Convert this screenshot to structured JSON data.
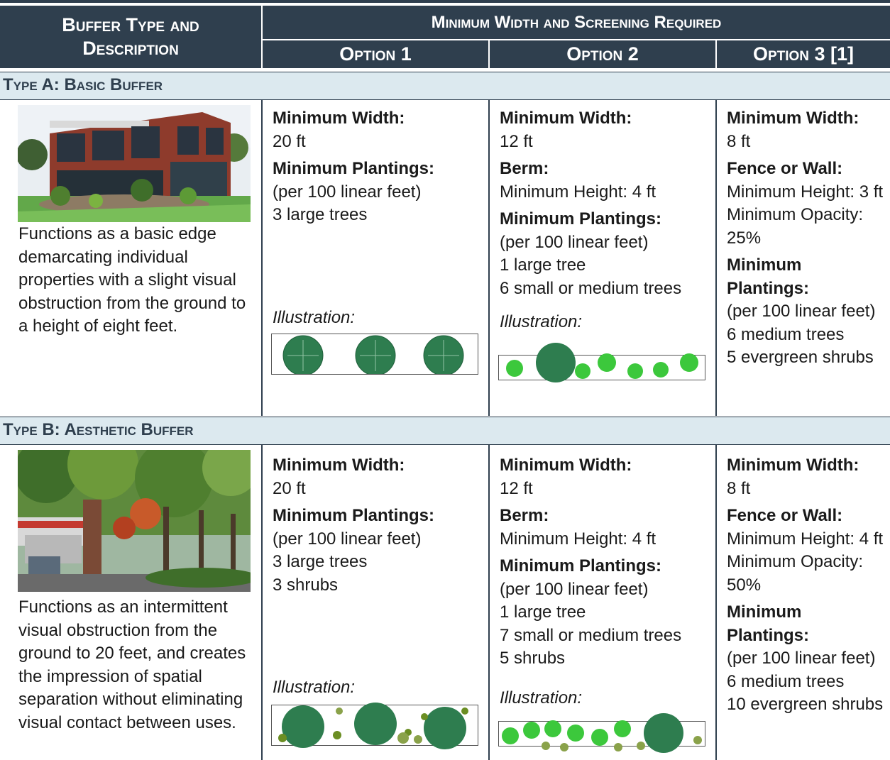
{
  "header": {
    "col1": "Buffer Type and Description",
    "group": "Minimum Width and Screening Required",
    "opt1": "Option 1",
    "opt2": "Option 2",
    "opt3": "Option 3 [1]"
  },
  "typeA": {
    "title": "Type A: Basic Buffer",
    "description": "Functions as a basic edge demarcating individual properties with a slight visual obstruction from the ground to a height of eight feet.",
    "opt1": {
      "width_label": "Minimum Width:",
      "width_value": "20 ft",
      "plant_label": "Minimum Plantings:",
      "plant_per": "(per 100 linear feet)",
      "plant_items": [
        "3 large trees"
      ],
      "illus_label": "Illustration:"
    },
    "opt2": {
      "width_label": "Minimum Width:",
      "width_value": "12 ft",
      "berm_label": "Berm:",
      "berm_value": "Minimum Height: 4 ft",
      "plant_label": "Minimum Plantings:",
      "plant_per": "(per 100 linear feet)",
      "plant_items": [
        "1 large tree",
        "6 small or medium trees"
      ],
      "illus_label": "Illustration:"
    },
    "opt3": {
      "width_label": "Minimum Width:",
      "width_value": "8 ft",
      "fence_label": "Fence or Wall:",
      "fence_value": "Minimum Height: 3 ft Minimum Opacity: 25%",
      "plant_label": "Minimum Plantings:",
      "plant_per": "(per 100 linear feet)",
      "plant_items": [
        "6 medium trees",
        "5 evergreen shrubs"
      ]
    }
  },
  "typeB": {
    "title": "Type B: Aesthetic Buffer",
    "description": "Functions as an intermittent visual obstruction from the ground to 20 feet, and creates the impression of spatial separation without eliminating visual contact between uses.",
    "opt1": {
      "width_label": "Minimum Width:",
      "width_value": "20 ft",
      "plant_label": "Minimum Plantings:",
      "plant_per": "(per 100 linear feet)",
      "plant_items": [
        "3 large trees",
        "3 shrubs"
      ],
      "illus_label": "Illustration:"
    },
    "opt2": {
      "width_label": "Minimum Width:",
      "width_value": "12 ft",
      "berm_label": "Berm:",
      "berm_value": "Minimum Height: 4 ft",
      "plant_label": "Minimum Plantings:",
      "plant_per": "(per 100 linear feet)",
      "plant_items": [
        "1 large tree",
        "7 small or medium trees",
        "5 shrubs"
      ],
      "illus_label": "Illustration:"
    },
    "opt3": {
      "width_label": "Minimum Width:",
      "width_value": "8 ft",
      "fence_label": "Fence or Wall:",
      "fence_value": "Minimum Height: 4 ft Minimum Opacity: 50%",
      "plant_label": "Minimum Plantings:",
      "plant_per": "(per 100 linear feet)",
      "plant_items": [
        "6 medium trees",
        "10 evergreen shrubs"
      ]
    }
  },
  "colors": {
    "header_bg": "#2f3f4e",
    "band_bg": "#dce9ef",
    "tree_dark": "#2e7d4f",
    "tree_light": "#3cc83c",
    "shrub": "#6b8e23"
  }
}
